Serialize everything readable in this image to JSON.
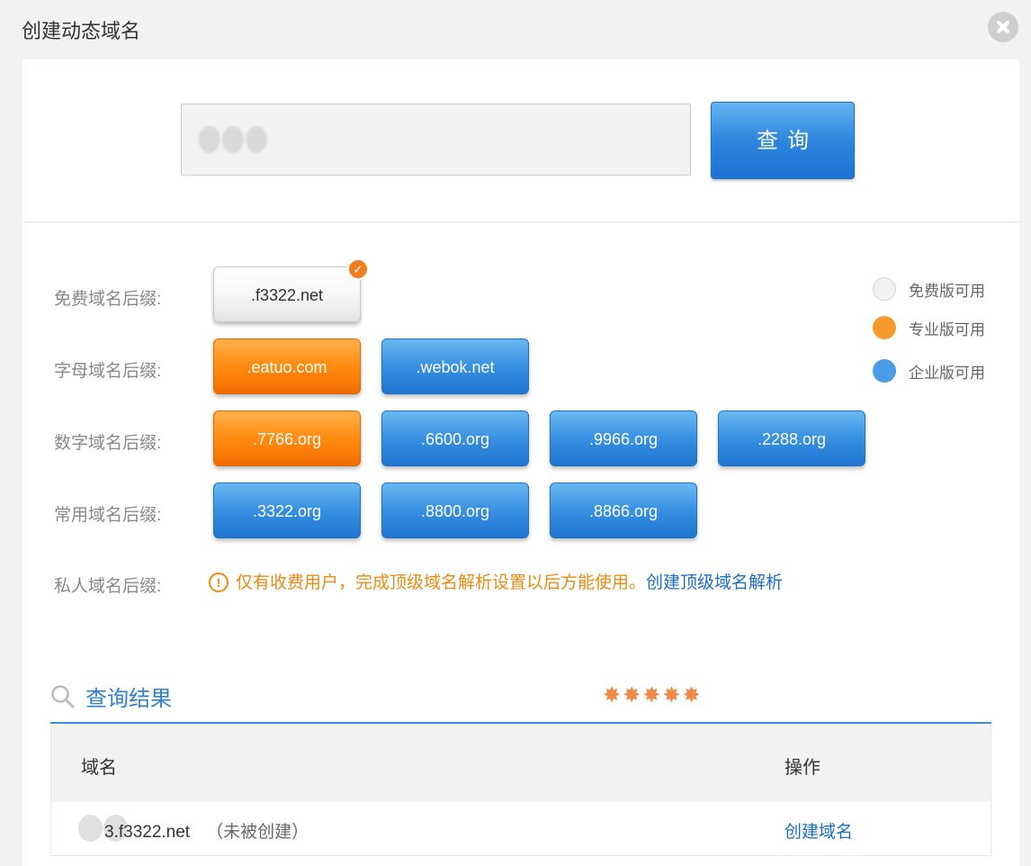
{
  "dialog": {
    "title": "创建动态域名",
    "close_icon": "close-circle-icon"
  },
  "search": {
    "input_value": "3",
    "query_label": "查询"
  },
  "suffix_rows": [
    {
      "label": "免费域名后缀:",
      "items": [
        ".f3322.net"
      ]
    },
    {
      "label": "字母域名后缀:",
      "items": [
        ".eatuo.com",
        ".webok.net"
      ]
    },
    {
      "label": "数字域名后缀:",
      "items": [
        ".7766.org",
        ".6600.org",
        ".9966.org",
        ".2288.org"
      ]
    },
    {
      "label": "常用域名后缀:",
      "items": [
        ".3322.org",
        ".8800.org",
        ".8866.org"
      ]
    },
    {
      "label": "私人域名后缀:"
    }
  ],
  "selected_suffix": ".f3322.net",
  "check_icon": "checkmark-badge-icon",
  "legend": [
    {
      "label": "免费版可用",
      "color": "#e8e8e8"
    },
    {
      "label": "专业版可用",
      "color": "#f79a2a"
    },
    {
      "label": "企业版可用",
      "color": "#4a9ce6"
    }
  ],
  "private_notice": {
    "icon": "info-icon",
    "text": "仅有收费用户，完成顶级域名解析设置以后方能使用。",
    "link": "创建顶级域名解析"
  },
  "results": {
    "title": "查询结果",
    "rating_icon": "stars-rating-icon",
    "rating": 5,
    "columns": [
      "域名",
      "操作"
    ],
    "rows": [
      {
        "domain": "3.f3322.net",
        "status": "（未被创建）",
        "action": "创建域名"
      }
    ]
  },
  "colors": {
    "accent_blue": "#2f7fd3",
    "orange": "#f26b00",
    "link_blue": "#1a6ec9",
    "warning": "#e98b12"
  }
}
